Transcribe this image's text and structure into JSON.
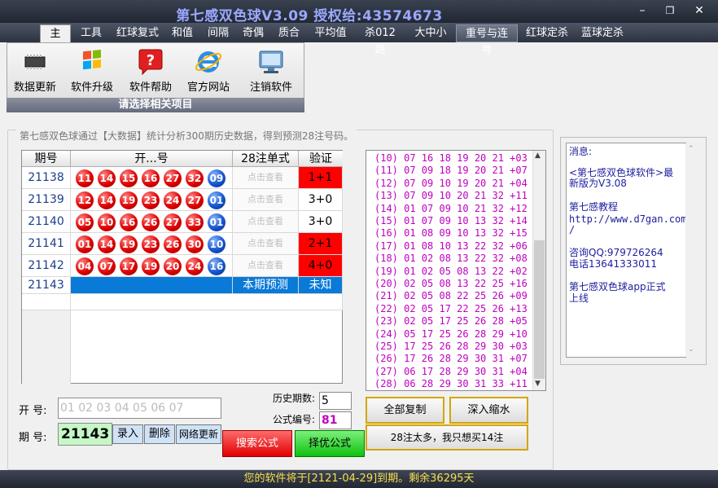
{
  "window": {
    "title": "第七感双色球V3.09  授权给:43574673"
  },
  "menu": [
    "主页",
    "工具",
    "红球复式",
    "和值",
    "间隔",
    "奇偶",
    "质合",
    "平均值",
    "杀012路",
    "大中小",
    "重号与连号",
    "红球定杀",
    "蓝球定杀"
  ],
  "toolbar": {
    "caption": "请选择相关项目",
    "items": [
      "数据更新",
      "软件升级",
      "软件帮助",
      "官方网站",
      "注销软件"
    ]
  },
  "group_title": "第七感双色球通过【大数据】统计分析300期历史数据，得到预测28注号码。",
  "grid": {
    "headers": [
      "期号",
      "开...号",
      "28注单式",
      "验证"
    ],
    "rows": [
      {
        "period": "21138",
        "reds": [
          "11",
          "14",
          "15",
          "16",
          "27",
          "32"
        ],
        "blue": "09",
        "detail": "点击查看",
        "verify": "1+1",
        "hit": true
      },
      {
        "period": "21139",
        "reds": [
          "12",
          "14",
          "19",
          "23",
          "24",
          "27"
        ],
        "blue": "01",
        "detail": "点击查看",
        "verify": "3+0",
        "hit": false
      },
      {
        "period": "21140",
        "reds": [
          "05",
          "10",
          "16",
          "26",
          "27",
          "33"
        ],
        "blue": "01",
        "detail": "点击查看",
        "verify": "3+0",
        "hit": false
      },
      {
        "period": "21141",
        "reds": [
          "01",
          "14",
          "19",
          "23",
          "26",
          "30"
        ],
        "blue": "10",
        "detail": "点击查看",
        "verify": "2+1",
        "hit": true
      },
      {
        "period": "21142",
        "reds": [
          "04",
          "07",
          "17",
          "19",
          "20",
          "24"
        ],
        "blue": "16",
        "detail": "点击查看",
        "verify": "4+0",
        "hit": true
      }
    ],
    "current": {
      "period": "21143",
      "label": "本期预测",
      "verify": "未知"
    }
  },
  "predictions": [
    "(10) 07 16 18 19 20 21 +03",
    "(11) 07 09 18 19 20 21 +07",
    "(12) 07 09 10 19 20 21 +04",
    "(13) 07 09 10 20 21 32 +11",
    "(14) 01 07 09 10 21 32 +12",
    "(15) 01 07 09 10 13 32 +14",
    "(16) 01 08 09 10 13 32 +15",
    "(17) 01 08 10 13 22 32 +06",
    "(18) 01 02 08 13 22 32 +08",
    "(19) 01 02 05 08 13 22 +02",
    "(20) 02 05 08 13 22 25 +16",
    "(21) 02 05 08 22 25 26 +09",
    "(22) 02 05 17 22 25 26 +13",
    "(23) 02 05 17 25 26 28 +05",
    "(24) 05 17 25 26 28 29 +10",
    "(25) 17 25 26 28 29 30 +03",
    "(26) 17 26 28 29 30 31 +07",
    "(27) 06 17 28 29 30 31 +04",
    "(28) 06 28 29 30 31 33 +11"
  ],
  "message": {
    "lines": [
      "消息:",
      "<第七感双色球软件>最",
      "新版为V3.08",
      "第七感教程",
      "http://www.d7gan.com",
      "/",
      "咨询QQ:979726264",
      "电话13641333011",
      "第七感双色球app正式",
      "上线"
    ]
  },
  "form": {
    "kai_label": "开  号:",
    "kai_value": "01 02 03 04 05 06 07",
    "qi_label": "期  号:",
    "qi_value": "21143",
    "history_label": "历史期数:",
    "history_value": "5",
    "formula_label": "公式编号:",
    "formula_value": "81",
    "btn_enter": "录入",
    "btn_delete": "删除",
    "btn_net": "网络更新",
    "btn_search": "搜索公式",
    "btn_optimal": "择优公式",
    "btn_copy": "全部复制",
    "btn_deep": "深入缩水",
    "btn_14": "28注太多，我只想买14注"
  },
  "status": "您的软件将于[2121-04-29]到期。剩余36295天",
  "colors": {
    "red_ball": "#e00000",
    "blue_ball": "#1456d0",
    "current_row": "#0a7ad8",
    "hit": "#ff0000",
    "prediction_text": "#c000c0",
    "status_text": "#f5e04a"
  }
}
